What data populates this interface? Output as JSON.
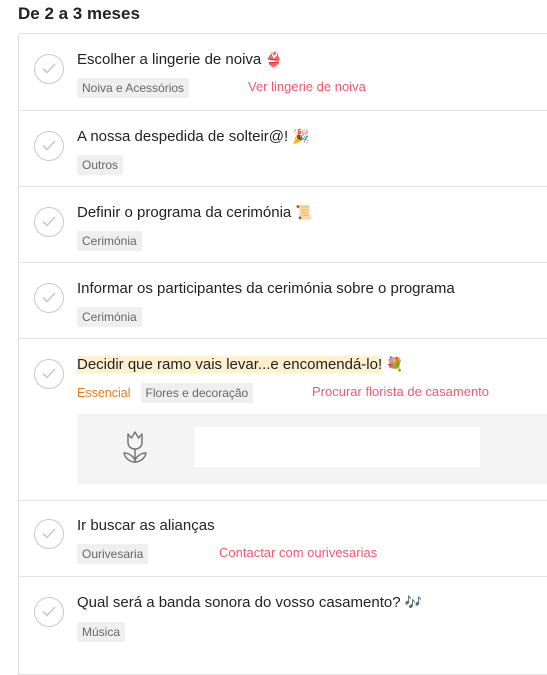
{
  "section": {
    "title": "De 2 a 3 meses"
  },
  "tasks": [
    {
      "title": "Escolher a lingerie de noiva",
      "emoji": "👙",
      "tags": [
        "Noiva e Acessórios"
      ],
      "link": "Ver lingerie de noiva"
    },
    {
      "title": "A nossa despedida de solteir@!",
      "emoji": "🎉",
      "tags": [
        "Outros"
      ]
    },
    {
      "title": "Definir o programa da cerimónia",
      "emoji": "📜",
      "tags": [
        "Cerimónia"
      ]
    },
    {
      "title": "Informar os participantes da cerimónia sobre o programa",
      "tags": [
        "Cerimónia"
      ]
    },
    {
      "title": "Decidir que ramo vais levar...e encomendá-lo!",
      "emoji": "💐",
      "essential": "Essencial",
      "tags": [
        "Flores e decoração"
      ],
      "link": "Procurar florista de casamento",
      "promo_icon": "tulip-icon"
    },
    {
      "title": "Ir buscar as alianças",
      "tags": [
        "Ourivesaria"
      ],
      "link": "Contactar com ourivesarias"
    },
    {
      "title": "Qual será a banda sonora do vosso casamento?",
      "emoji": "🎶",
      "tags": [
        "Música"
      ]
    }
  ],
  "colors": {
    "accent_link": "#ee5a6f",
    "essential": "#e67e22",
    "highlight": "#fdf0cf",
    "tag_bg": "#efefef"
  }
}
